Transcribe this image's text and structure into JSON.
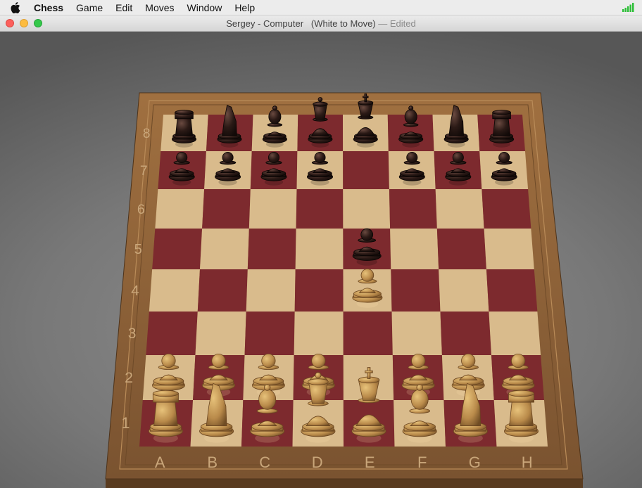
{
  "menubar": {
    "app": "Chess",
    "items": [
      "Game",
      "Edit",
      "Moves",
      "Window",
      "Help"
    ],
    "apple_icon": "apple-icon",
    "status_icon": "signal-icon"
  },
  "window": {
    "title_main": "Sergey - Computer",
    "title_status": "(White to Move)",
    "title_sep": "—",
    "title_edited": "Edited"
  },
  "board": {
    "files": [
      "A",
      "B",
      "C",
      "D",
      "E",
      "F",
      "G",
      "H"
    ],
    "ranks": [
      "8",
      "7",
      "6",
      "5",
      "4",
      "3",
      "2",
      "1"
    ],
    "colors": {
      "light_square": "#d9bb8c",
      "dark_square": "#7d2a2e",
      "frame": "#8c6239",
      "label": "#c9a67a",
      "white_piece": "#b98a4a",
      "black_piece": "#2b1a16"
    },
    "pieces": [
      {
        "piece": "rook",
        "color": "black",
        "square": "a8"
      },
      {
        "piece": "knight",
        "color": "black",
        "square": "b8"
      },
      {
        "piece": "bishop",
        "color": "black",
        "square": "c8"
      },
      {
        "piece": "queen",
        "color": "black",
        "square": "d8"
      },
      {
        "piece": "king",
        "color": "black",
        "square": "e8"
      },
      {
        "piece": "bishop",
        "color": "black",
        "square": "f8"
      },
      {
        "piece": "knight",
        "color": "black",
        "square": "g8"
      },
      {
        "piece": "rook",
        "color": "black",
        "square": "h8"
      },
      {
        "piece": "pawn",
        "color": "black",
        "square": "a7"
      },
      {
        "piece": "pawn",
        "color": "black",
        "square": "b7"
      },
      {
        "piece": "pawn",
        "color": "black",
        "square": "c7"
      },
      {
        "piece": "pawn",
        "color": "black",
        "square": "d7"
      },
      {
        "piece": "pawn",
        "color": "black",
        "square": "f7"
      },
      {
        "piece": "pawn",
        "color": "black",
        "square": "g7"
      },
      {
        "piece": "pawn",
        "color": "black",
        "square": "h7"
      },
      {
        "piece": "pawn",
        "color": "black",
        "square": "e5"
      },
      {
        "piece": "pawn",
        "color": "white",
        "square": "e4"
      },
      {
        "piece": "pawn",
        "color": "white",
        "square": "a2"
      },
      {
        "piece": "pawn",
        "color": "white",
        "square": "b2"
      },
      {
        "piece": "pawn",
        "color": "white",
        "square": "c2"
      },
      {
        "piece": "pawn",
        "color": "white",
        "square": "d2"
      },
      {
        "piece": "pawn",
        "color": "white",
        "square": "f2"
      },
      {
        "piece": "pawn",
        "color": "white",
        "square": "g2"
      },
      {
        "piece": "pawn",
        "color": "white",
        "square": "h2"
      },
      {
        "piece": "rook",
        "color": "white",
        "square": "a1"
      },
      {
        "piece": "knight",
        "color": "white",
        "square": "b1"
      },
      {
        "piece": "bishop",
        "color": "white",
        "square": "c1"
      },
      {
        "piece": "queen",
        "color": "white",
        "square": "d1"
      },
      {
        "piece": "king",
        "color": "white",
        "square": "e1"
      },
      {
        "piece": "bishop",
        "color": "white",
        "square": "f1"
      },
      {
        "piece": "knight",
        "color": "white",
        "square": "g1"
      },
      {
        "piece": "rook",
        "color": "white",
        "square": "h1"
      }
    ]
  }
}
